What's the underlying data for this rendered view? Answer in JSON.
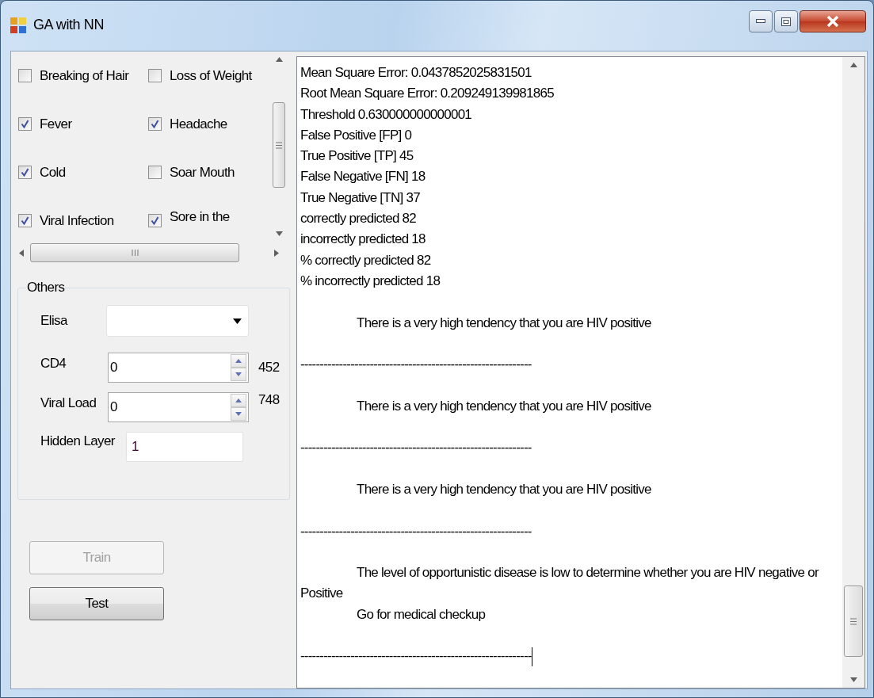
{
  "window": {
    "title": "GA with NN"
  },
  "symptoms": [
    {
      "label": "Breaking of Hair",
      "checked": false
    },
    {
      "label": "Loss of Weight",
      "checked": false
    },
    {
      "label": "Fever",
      "checked": true
    },
    {
      "label": "Headache",
      "checked": true
    },
    {
      "label": "Cold",
      "checked": true
    },
    {
      "label": "Soar Mouth",
      "checked": false
    },
    {
      "label": "Viral Infection",
      "checked": true
    },
    {
      "label": "Sore in the",
      "checked": true
    }
  ],
  "others": {
    "title": "Others",
    "fields": [
      {
        "kind": "combo",
        "label": "Elisa"
      },
      {
        "kind": "spin",
        "label": "CD4",
        "value": "0",
        "reading": "452"
      },
      {
        "kind": "spin",
        "label": "Viral Load",
        "value": "0",
        "reading": "748"
      },
      {
        "kind": "text",
        "label": "Hidden Layer",
        "value": "1"
      }
    ]
  },
  "buttons": [
    {
      "label": "Train",
      "disabled": true
    },
    {
      "label": "Test",
      "disabled": false
    }
  ],
  "output": [
    {
      "kind": "stat",
      "text": "Mean Square Error: 0.0437852025831501"
    },
    {
      "kind": "stat",
      "text": "Root Mean Square Error: 0.209249139981865"
    },
    {
      "kind": "stat",
      "text": "Threshold 0.630000000000001"
    },
    {
      "kind": "stat",
      "text": "False Positive [FP]  0"
    },
    {
      "kind": "stat",
      "text": "True Positive [TP] 45"
    },
    {
      "kind": "stat",
      "text": "False Negative [FN] 18"
    },
    {
      "kind": "stat",
      "text": "True Negative [TN] 37"
    },
    {
      "kind": "stat",
      "text": "correctly predicted 82"
    },
    {
      "kind": "stat",
      "text": "incorrectly predicted 18"
    },
    {
      "kind": "stat",
      "text": "% correctly predicted 82"
    },
    {
      "kind": "stat",
      "text": "% incorrectly predicted 18"
    },
    {
      "kind": "message",
      "lines": [
        "There is a very high tendency that you are HIV positive"
      ]
    },
    {
      "kind": "separator",
      "text": "------------------------------------------------------------",
      "caret": false
    },
    {
      "kind": "message",
      "lines": [
        "There is a very high tendency that you are HIV positive"
      ]
    },
    {
      "kind": "separator",
      "text": "------------------------------------------------------------",
      "caret": false
    },
    {
      "kind": "message",
      "lines": [
        "There is a very high tendency that you are HIV positive"
      ]
    },
    {
      "kind": "separator",
      "text": "------------------------------------------------------------",
      "caret": false
    },
    {
      "kind": "message",
      "lines": [
        "The level of opportunistic disease is low to determine whether you are HIV negative or Positive",
        "Go for medical checkup"
      ]
    },
    {
      "kind": "separator",
      "text": "------------------------------------------------------------",
      "caret": true
    }
  ]
}
